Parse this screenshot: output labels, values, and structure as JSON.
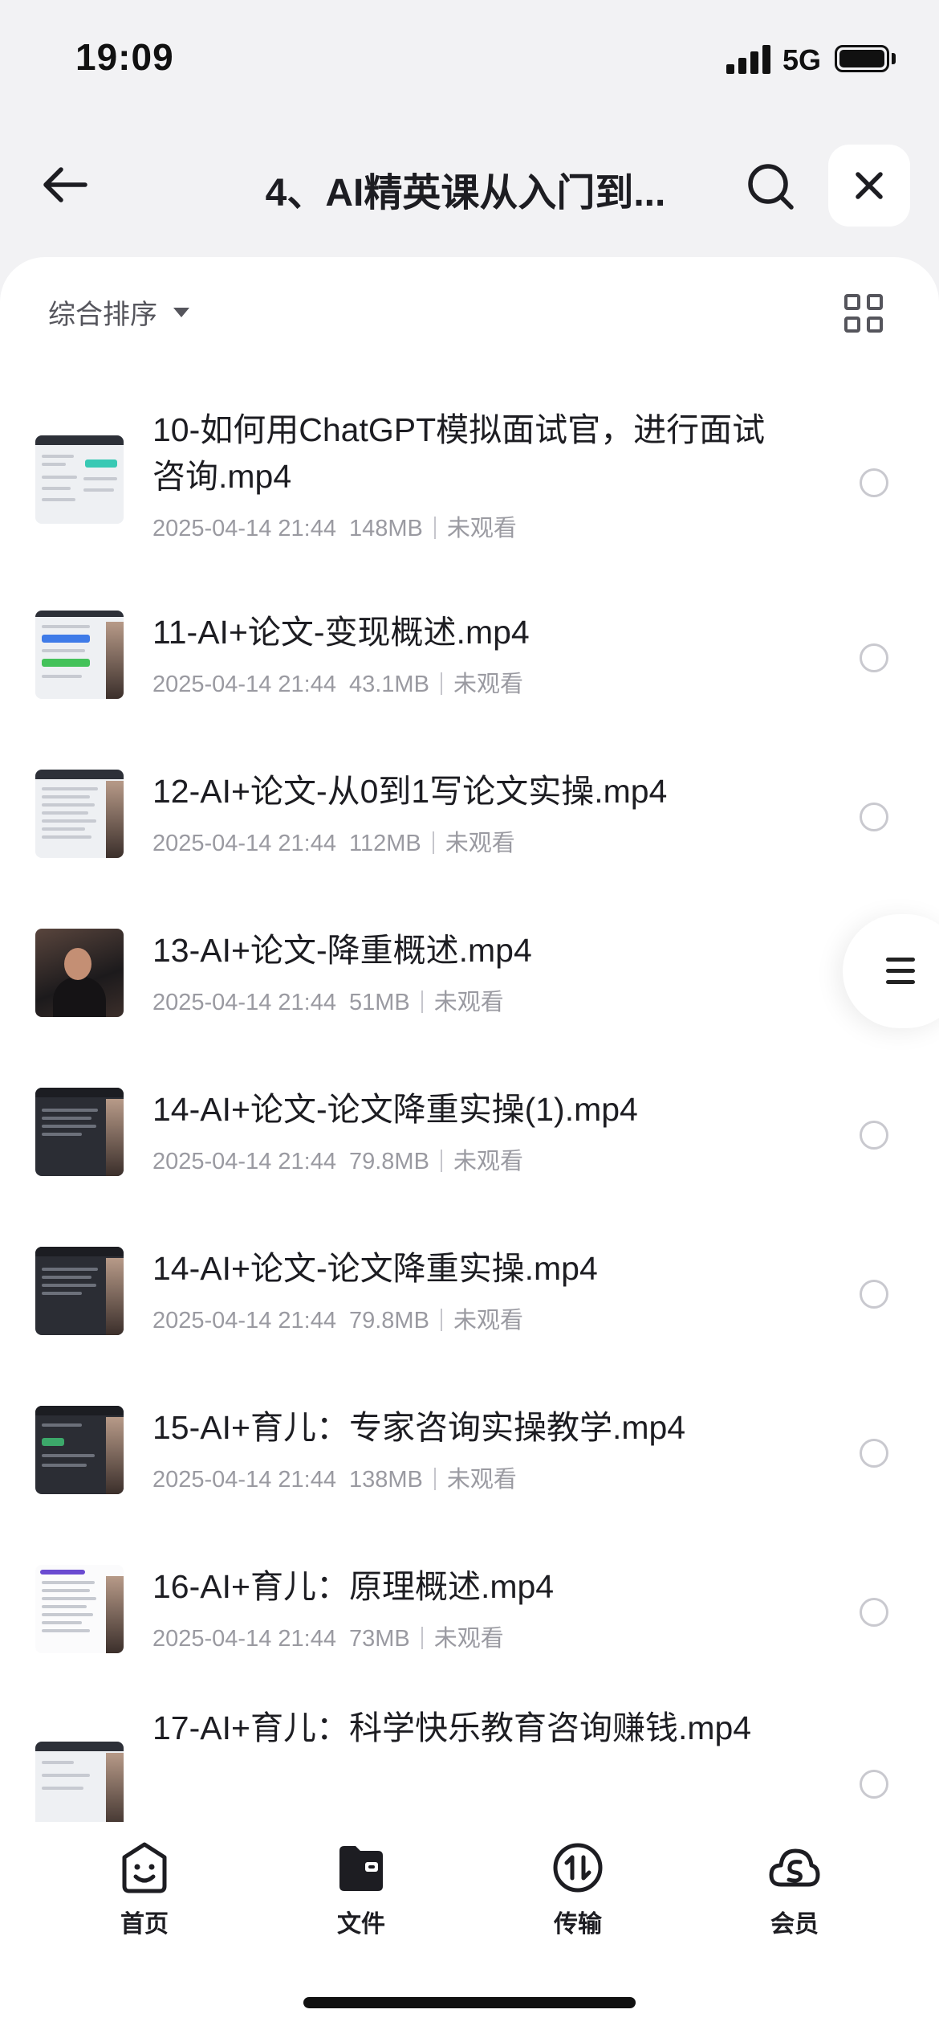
{
  "status": {
    "time": "19:09",
    "network": "5G"
  },
  "nav": {
    "title": "4、AI精英课从入门到..."
  },
  "toolbar": {
    "sort_label": "综合排序"
  },
  "files": [
    {
      "name": "10-如何用ChatGPT模拟面试官，进行面试咨询.mp4",
      "date": "2025-04-14 21:44",
      "size": "148MB",
      "status": "未观看"
    },
    {
      "name": "11-AI+论文-变现概述.mp4",
      "date": "2025-04-14 21:44",
      "size": "43.1MB",
      "status": "未观看"
    },
    {
      "name": "12-AI+论文-从0到1写论文实操.mp4",
      "date": "2025-04-14 21:44",
      "size": "112MB",
      "status": "未观看"
    },
    {
      "name": "13-AI+论文-降重概述.mp4",
      "date": "2025-04-14 21:44",
      "size": "51MB",
      "status": "未观看"
    },
    {
      "name": "14-AI+论文-论文降重实操(1).mp4",
      "date": "2025-04-14 21:44",
      "size": "79.8MB",
      "status": "未观看"
    },
    {
      "name": "14-AI+论文-论文降重实操.mp4",
      "date": "2025-04-14 21:44",
      "size": "79.8MB",
      "status": "未观看"
    },
    {
      "name": "15-AI+育儿：专家咨询实操教学.mp4",
      "date": "2025-04-14 21:44",
      "size": "138MB",
      "status": "未观看"
    },
    {
      "name": "16-AI+育儿：原理概述.mp4",
      "date": "2025-04-14 21:44",
      "size": "73MB",
      "status": "未观看"
    },
    {
      "name": "17-AI+育儿：科学快乐教育咨询赚钱.mp4",
      "date": "",
      "size": "",
      "status": ""
    }
  ],
  "tabs": [
    {
      "label": "首页",
      "icon": "smile-icon"
    },
    {
      "label": "文件",
      "icon": "folder-icon"
    },
    {
      "label": "传输",
      "icon": "transfer-icon"
    },
    {
      "label": "会员",
      "icon": "cloud-icon"
    }
  ]
}
